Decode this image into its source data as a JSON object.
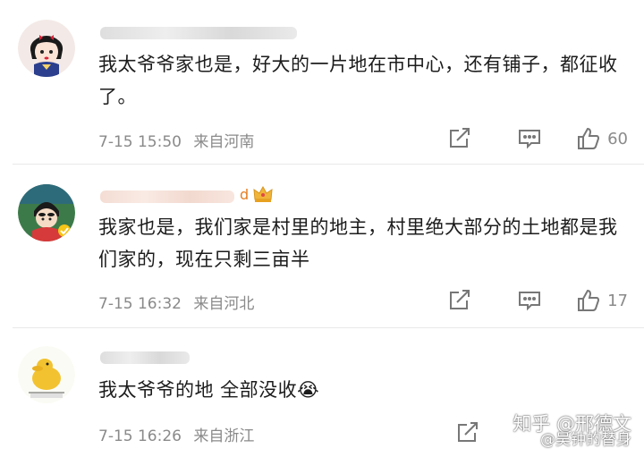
{
  "comments": [
    {
      "text": "我太爷爷家也是，好大的一片地在市中心，还有铺子，都征收了。",
      "time": "7-15 15:50",
      "location": "来自河南",
      "likes": "60",
      "username_partial": ""
    },
    {
      "text": "我家也是，我们家是村里的地主，村里绝大部分的土地都是我们家的，现在只剩三亩半",
      "time": "7-15 16:32",
      "location": "来自河北",
      "likes": "17",
      "username_partial": "d"
    },
    {
      "text": "我太爷爷的地 全部没收😭",
      "time": "7-15 16:26",
      "location": "来自浙江",
      "likes": ""
    }
  ],
  "watermark": {
    "line1": "知乎 @邢德文",
    "line2": "@吴钟的替身"
  },
  "colors": {
    "text": "#1c1c1c",
    "meta": "#8a8a8a",
    "divider": "#e9e9e9"
  },
  "icons": [
    "share-icon",
    "comment-icon",
    "like-icon",
    "crown-icon"
  ]
}
